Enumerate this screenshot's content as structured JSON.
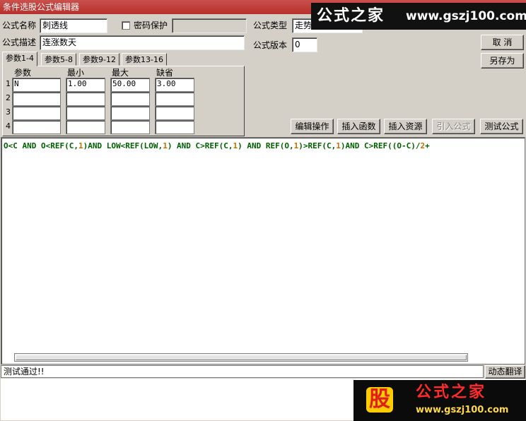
{
  "window": {
    "title": "条件选股公式编辑器"
  },
  "form": {
    "name_label": "公式名称",
    "name_value": "刺透线",
    "password_label": "密码保护",
    "password_value": "",
    "desc_label": "公式描述",
    "desc_value": "连涨数天",
    "type_label": "公式类型",
    "type_value": "走势",
    "version_label": "公式版本",
    "version_value": "0"
  },
  "buttons": {
    "cancel": "取  消",
    "save_as": "另存为",
    "edit_ops": "编辑操作",
    "insert_func": "插入函数",
    "insert_res": "插入资源",
    "import_formula": "引入公式",
    "test_formula": "测试公式",
    "dynamic_translate": "动态翻译"
  },
  "tabs": [
    "参数1-4",
    "参数5-8",
    "参数9-12",
    "参数13-16"
  ],
  "params": {
    "headers": [
      "参数",
      "最小",
      "最大",
      "缺省"
    ],
    "rows": [
      {
        "num": "1",
        "name": "N",
        "min": "1.00",
        "max": "50.00",
        "default": "3.00"
      },
      {
        "num": "2",
        "name": "",
        "min": "",
        "max": "",
        "default": ""
      },
      {
        "num": "3",
        "name": "",
        "min": "",
        "max": "",
        "default": ""
      },
      {
        "num": "4",
        "name": "",
        "min": "",
        "max": "",
        "default": ""
      }
    ]
  },
  "code": {
    "text": "O<C AND O<REF(C,1)AND LOW<REF(LOW,1) AND C>REF(C,1) AND REF(O,1)>REF(C,1)AND C>REF((O-C)/2+",
    "colors": {
      "keyword": "#006000",
      "number": "#c07000",
      "operator": "#006000"
    }
  },
  "status": {
    "text": "测试通过!!"
  },
  "watermarks": {
    "top_cn": "公式之家",
    "top_url": "www.gszj100.com",
    "bottom_logo": "股",
    "bottom_cn": "公式之家",
    "bottom_url": "www.gszj100.com"
  }
}
